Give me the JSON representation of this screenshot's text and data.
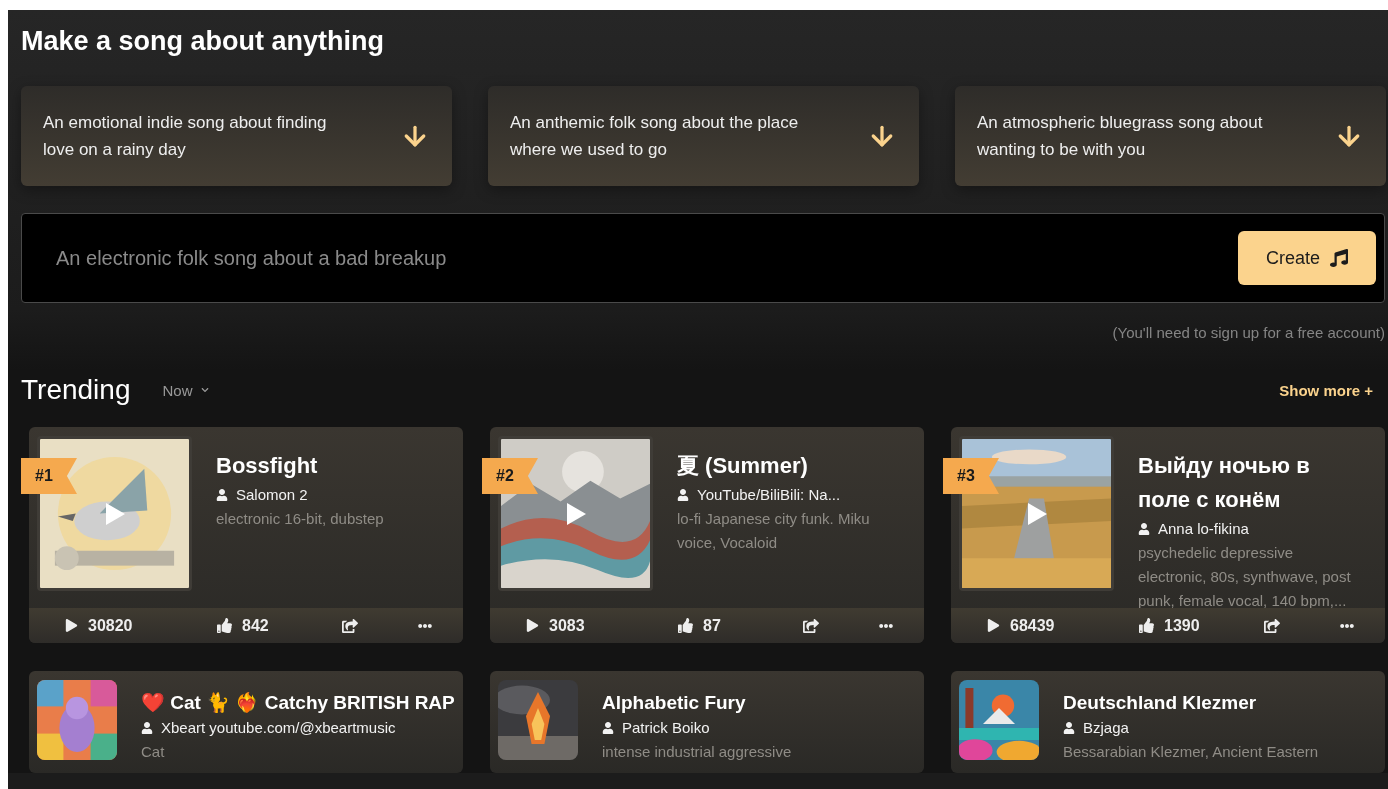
{
  "title": "Make a song about anything",
  "suggestions": [
    {
      "text": "An emotional indie song about finding love on a rainy day"
    },
    {
      "text": "An anthemic folk song about the place where we used to go"
    },
    {
      "text": "An atmospheric bluegrass song about wanting to be with you"
    }
  ],
  "prompt": {
    "placeholder": "An electronic folk song about a bad breakup",
    "button": "Create"
  },
  "note": "(You'll need to sign up for a free account)",
  "trending": {
    "title": "Trending",
    "filter": "Now",
    "show_more": "Show more +"
  },
  "songs": [
    {
      "rank": "#1",
      "title": "Bossfight",
      "author": "Salomon 2",
      "description": "electronic 16-bit, dubstep",
      "plays": "30820",
      "likes": "842"
    },
    {
      "rank": "#2",
      "title": "夏 (Summer)",
      "author": "YouTube/BiliBili: Na...",
      "description": "lo-fi Japanese city funk. Miku voice, Vocaloid",
      "plays": "3083",
      "likes": "87"
    },
    {
      "rank": "#3",
      "title": "Выйду ночью в поле с конём",
      "author": "Anna lo-fikina",
      "description": "psychedelic depressive electronic, 80s, synthwave, post punk, female vocal, 140 bpm,...",
      "plays": "68439",
      "likes": "1390"
    }
  ],
  "more_songs": [
    {
      "title": "❤️ Cat 🐈 ❤️‍🔥 Catchy BRITISH RAP",
      "author": "Xbeart youtube.com/@xbeartmusic",
      "description": "Cat"
    },
    {
      "title": "Alphabetic Fury",
      "author": "Patrick Boiko",
      "description": "intense industrial aggressive"
    },
    {
      "title": "Deutschland Klezmer",
      "author": "Bzjaga",
      "description": "Bessarabian Klezmer, Ancient Eastern"
    }
  ]
}
